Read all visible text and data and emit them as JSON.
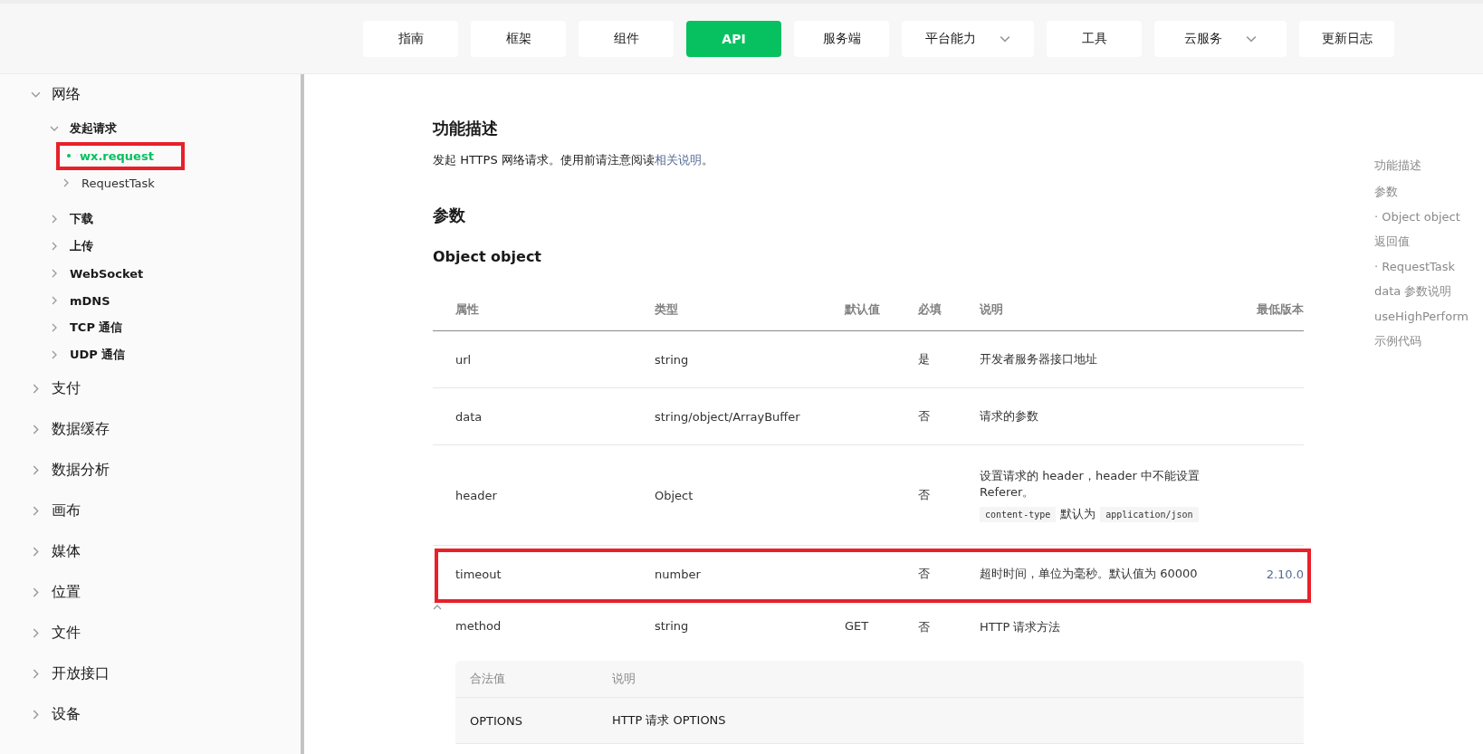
{
  "nav": [
    {
      "label": "指南",
      "selected": false,
      "dropdown": false
    },
    {
      "label": "框架",
      "selected": false,
      "dropdown": false
    },
    {
      "label": "组件",
      "selected": false,
      "dropdown": false
    },
    {
      "label": "API",
      "selected": true,
      "dropdown": false
    },
    {
      "label": "服务端",
      "selected": false,
      "dropdown": false
    },
    {
      "label": "平台能力",
      "selected": false,
      "dropdown": true
    },
    {
      "label": "工具",
      "selected": false,
      "dropdown": false
    },
    {
      "label": "云服务",
      "selected": false,
      "dropdown": true
    },
    {
      "label": "更新日志",
      "selected": false,
      "dropdown": false
    }
  ],
  "sidebar": {
    "items": [
      {
        "label": "网络",
        "expanded": true,
        "children": [
          {
            "label": "发起请求",
            "expanded": true,
            "children": [
              {
                "label": "wx.request",
                "kind": "leaf",
                "selected": true,
                "highlighted": true
              },
              {
                "label": "RequestTask",
                "kind": "branch",
                "selected": false,
                "highlighted": false
              }
            ]
          },
          {
            "label": "下载",
            "expanded": false
          },
          {
            "label": "上传",
            "expanded": false
          },
          {
            "label": "WebSocket",
            "expanded": false
          },
          {
            "label": "mDNS",
            "expanded": false
          },
          {
            "label": "TCP 通信",
            "expanded": false
          },
          {
            "label": "UDP 通信",
            "expanded": false
          }
        ]
      },
      {
        "label": "支付",
        "expanded": false
      },
      {
        "label": "数据缓存",
        "expanded": false
      },
      {
        "label": "数据分析",
        "expanded": false
      },
      {
        "label": "画布",
        "expanded": false
      },
      {
        "label": "媒体",
        "expanded": false
      },
      {
        "label": "位置",
        "expanded": false
      },
      {
        "label": "文件",
        "expanded": false
      },
      {
        "label": "开放接口",
        "expanded": false
      },
      {
        "label": "设备",
        "expanded": false
      }
    ]
  },
  "content": {
    "sections": [
      {
        "heading": "功能描述",
        "text": "发起 HTTPS 网络请求。使用前请注意阅读",
        "link": "相关说明",
        "text_end": "。"
      },
      {
        "heading": "参数"
      }
    ],
    "subheading": "Object object",
    "table": {
      "columns": [
        "属性",
        "类型",
        "默认值",
        "必填",
        "说明",
        "最低版本"
      ],
      "rows": [
        {
          "cells": [
            "url",
            "string",
            "",
            "是",
            "开发者服务器接口地址",
            ""
          ],
          "highlighted": false,
          "expanded": null
        },
        {
          "cells": [
            "data",
            "string/object/ArrayBuffer",
            "",
            "否",
            "请求的参数",
            ""
          ],
          "highlighted": false,
          "expanded": null
        },
        {
          "cells": [
            "header",
            "Object",
            "",
            "否",
            "设置请求的 header，header 中不能设置 Referer。",
            ""
          ],
          "note": {
            "code": "content-type",
            "text": "默认为",
            "code_end": "application/json"
          },
          "highlighted": false,
          "expanded": null
        },
        {
          "cells": [
            "timeout",
            "number",
            "",
            "否",
            "超时时间，单位为毫秒。默认值为 60000",
            "2.10.0"
          ],
          "highlighted": true,
          "expanded": null
        },
        {
          "cells": [
            "method",
            "string",
            "GET",
            "否",
            "HTTP 请求方法",
            ""
          ],
          "highlighted": false,
          "expanded": true,
          "subtable": {
            "columns": [
              "合法值",
              "说明"
            ],
            "rows": [
              [
                "OPTIONS",
                "HTTP 请求 OPTIONS"
              ]
            ]
          }
        }
      ]
    }
  },
  "toc": [
    "功能描述",
    "参数",
    "· Object object",
    "返回值",
    "· RequestTask",
    "data 参数说明",
    "useHighPerform",
    "示例代码"
  ]
}
